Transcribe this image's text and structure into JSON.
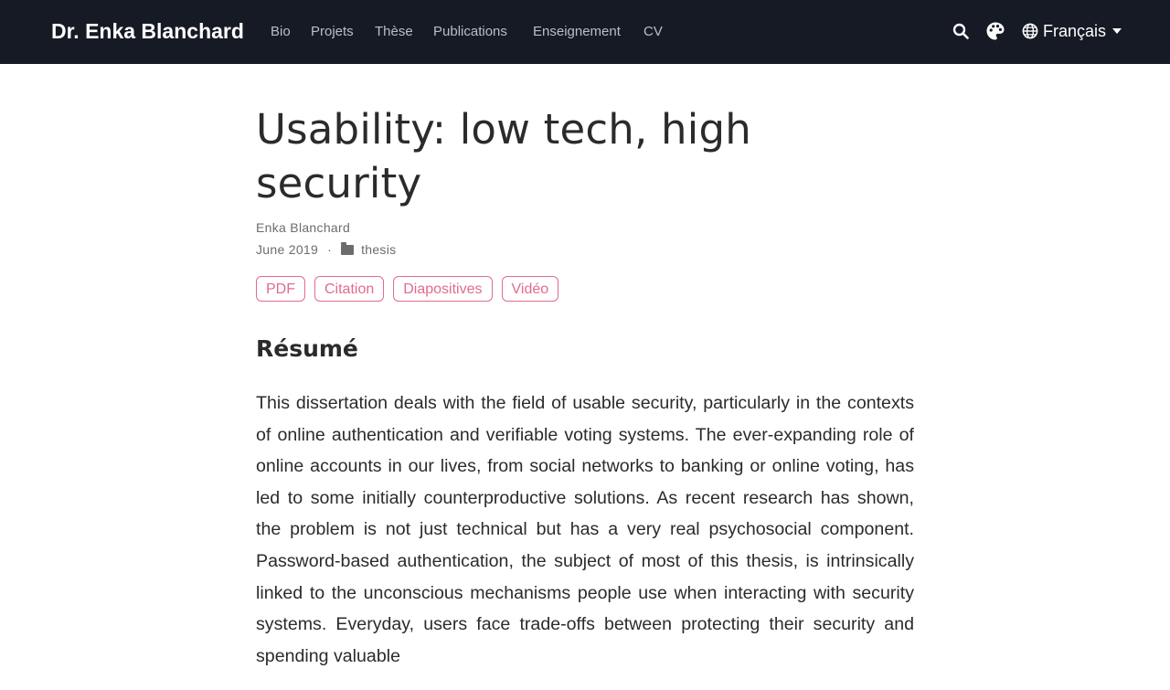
{
  "navbar": {
    "brand": "Dr. Enka Blanchard",
    "links": [
      "Bio",
      "Projets",
      "Thèse",
      "Publications",
      "Enseignement",
      "CV"
    ],
    "tools": {
      "search_icon": "search-icon",
      "theme_icon": "palette-icon",
      "language_icon": "globe-icon",
      "language_label": "Français"
    }
  },
  "article": {
    "title": "Usability: low tech, high security",
    "authors": "Enka Blanchard",
    "date": "June 2019",
    "separator": "·",
    "category": "thesis",
    "buttons": [
      "PDF",
      "Citation",
      "Diapositives",
      "Vidéo"
    ],
    "abstract_heading": "Résumé",
    "abstract": "This dissertation deals with the field of usable security, particularly in the contexts of online authentication and verifiable voting systems. The ever-expanding role of online accounts in our lives, from social networks to banking or online voting, has led to some initially counterproductive solutions. As recent research has shown, the problem is not just technical but has a very real psychosocial component. Password-based authentication, the subject of most of this thesis, is intrinsically linked to the unconscious mechanisms people use when interacting with security systems. Everyday, users face trade-offs between protecting their security and spending valuable"
  },
  "colors": {
    "navbar_bg": "#161a25",
    "accent": "#e06c8c",
    "text": "#2b2b2b",
    "muted": "#6c6c6c"
  }
}
